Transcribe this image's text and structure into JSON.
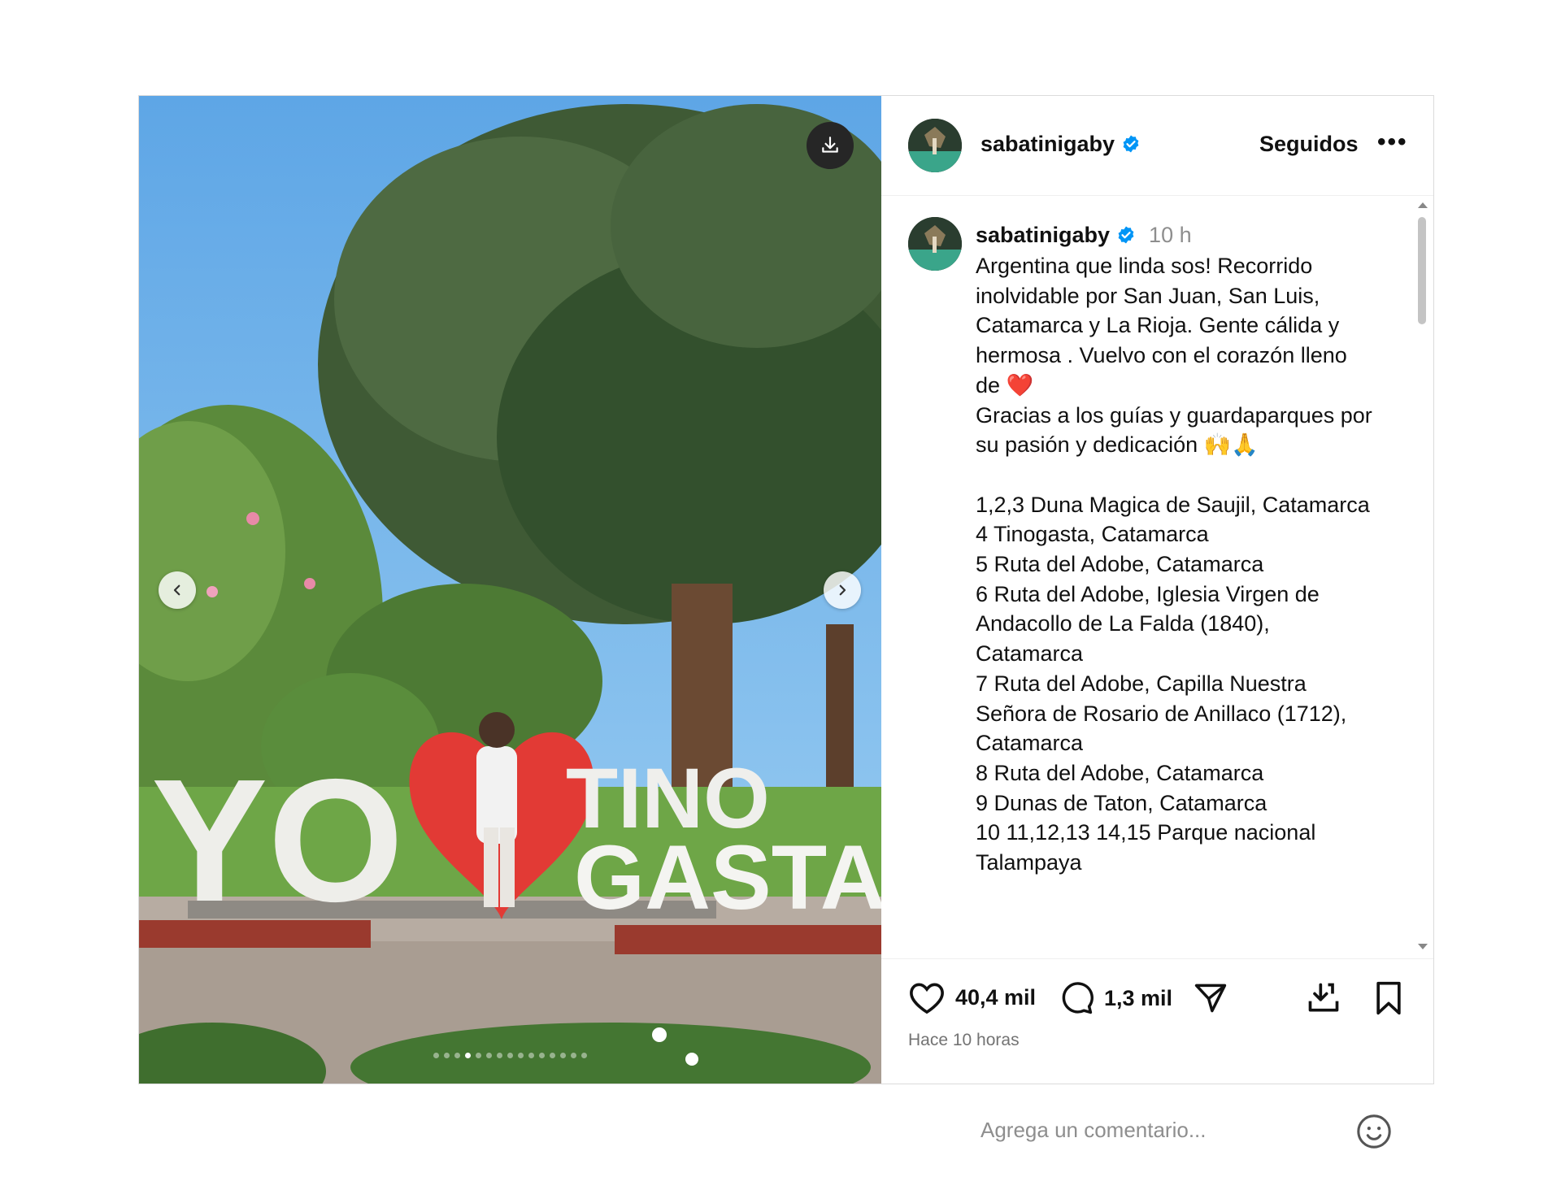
{
  "post": {
    "media": {
      "sign_left": "YO",
      "sign_right_top": "TINO",
      "sign_right_bottom": "GASTA",
      "slide_count": 15,
      "active_slide": 4,
      "download_icon": "download-icon",
      "prev_icon": "chevron-left-icon",
      "next_icon": "chevron-right-icon"
    },
    "header": {
      "username": "sabatinigaby",
      "follow_status": "Seguidos",
      "more_label": "•••"
    },
    "caption": {
      "username": "sabatinigaby",
      "time": "10 h",
      "text": "Argentina que linda sos! Recorrido\ninolvidable por San Juan, San Luis,\nCatamarca y La Rioja. Gente cálida y\nhermosa . Vuelvo con el corazón lleno\nde ❤️\nGracias a los guías y guardaparques por\nsu pasión y dedicación 🙌🙏\n\n1,2,3 Duna Magica de Saujil, Catamarca\n4 Tinogasta, Catamarca\n5 Ruta del Adobe, Catamarca\n6 Ruta del Adobe, Iglesia Virgen de\nAndacollo de La Falda (1840),\nCatamarca\n7 Ruta del Adobe, Capilla Nuestra\nSeñora de Rosario de Anillaco (1712),\nCatamarca\n8 Ruta del Adobe, Catamarca\n9 Dunas de Taton, Catamarca\n10 11,12,13 14,15 Parque nacional\nTalampaya"
    },
    "actions": {
      "likes": "40,4 mil",
      "comments": "1,3 mil",
      "posted_ago": "Hace 10 horas"
    },
    "comment": {
      "placeholder": "Agrega un comentario..."
    }
  }
}
